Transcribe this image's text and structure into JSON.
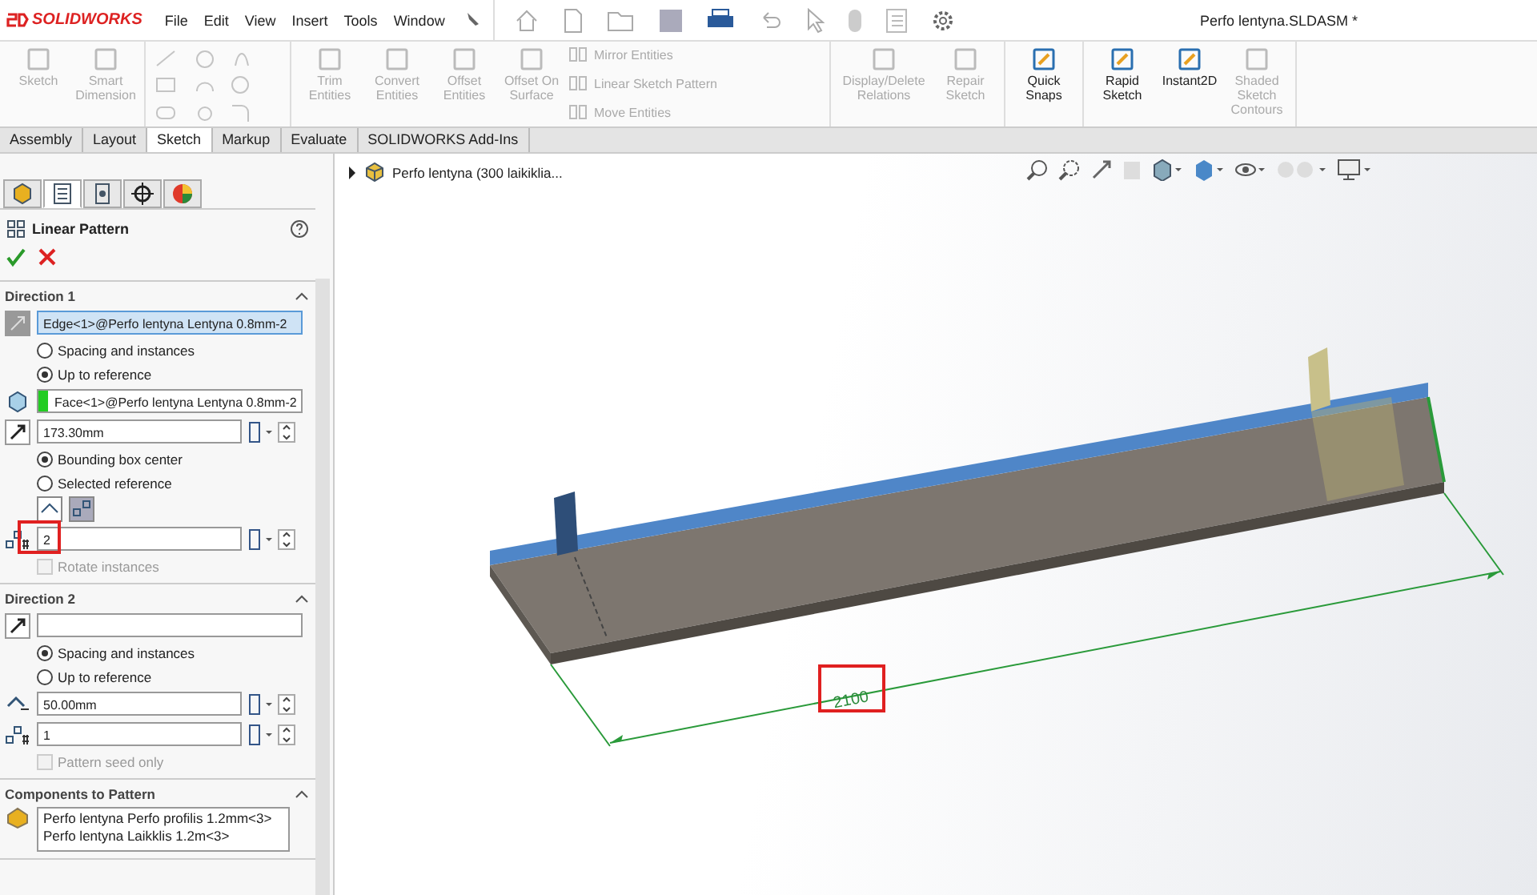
{
  "app": {
    "logo": "SOLIDWORKS"
  },
  "menu": [
    "File",
    "Edit",
    "View",
    "Insert",
    "Tools",
    "Window"
  ],
  "title": "Perfo lentyna.SLDASM *",
  "ribbon": {
    "groups": [
      {
        "items": [
          {
            "label": "Sketch",
            "kind": "large",
            "disabled": true
          },
          {
            "label": "Smart Dimension",
            "kind": "large",
            "disabled": true
          }
        ]
      },
      {
        "items": [
          {
            "kind": "tools",
            "disabled": true
          }
        ]
      },
      {
        "items": [
          {
            "label": "Trim Entities",
            "kind": "large",
            "disabled": true
          },
          {
            "label": "Convert Entities",
            "kind": "large",
            "disabled": true
          },
          {
            "label": "Offset Entities",
            "kind": "large",
            "disabled": true
          },
          {
            "label": "Offset On Surface",
            "kind": "large",
            "disabled": true
          },
          {
            "label": "Mirror Entities",
            "kind": "small",
            "disabled": true
          },
          {
            "label": "Linear Sketch Pattern",
            "kind": "small",
            "disabled": true
          },
          {
            "label": "Move Entities",
            "kind": "small",
            "disabled": true
          }
        ]
      },
      {
        "items": [
          {
            "label": "Display/Delete Relations",
            "kind": "large",
            "disabled": true
          },
          {
            "label": "Repair Sketch",
            "kind": "large",
            "disabled": true
          }
        ]
      },
      {
        "items": [
          {
            "label": "Quick Snaps",
            "kind": "large",
            "disabled": false
          }
        ]
      },
      {
        "items": [
          {
            "label": "Rapid Sketch",
            "kind": "large",
            "disabled": false
          },
          {
            "label": "Instant2D",
            "kind": "large",
            "disabled": false
          },
          {
            "label": "Shaded Sketch Contours",
            "kind": "large",
            "disabled": true
          }
        ]
      }
    ]
  },
  "tabs": [
    {
      "label": "Assembly",
      "selected": false
    },
    {
      "label": "Layout",
      "selected": false
    },
    {
      "label": "Sketch",
      "selected": true
    },
    {
      "label": "Markup",
      "selected": false
    },
    {
      "label": "Evaluate",
      "selected": false
    },
    {
      "label": "SOLIDWORKS Add-Ins",
      "selected": false
    }
  ],
  "panel_tabs": [
    {
      "selected": false
    },
    {
      "selected": true
    },
    {
      "selected": false
    },
    {
      "selected": false
    },
    {
      "selected": false
    }
  ],
  "feature": {
    "title": "Linear Pattern"
  },
  "direction_1": {
    "heading": "Direction 1",
    "edge": "Edge<1>@Perfo lentyna Lentyna 0.8mm-2",
    "modes": [
      {
        "label": "Spacing and instances",
        "selected": false
      },
      {
        "label": "Up to reference",
        "selected": true
      }
    ],
    "face": "Face<1>@Perfo lentyna Lentyna 0.8mm-2",
    "offset": "173.30mm",
    "references": [
      {
        "label": "Bounding box center",
        "selected": true
      },
      {
        "label": "Selected reference",
        "selected": false
      }
    ],
    "instances": {
      "value": "2",
      "highlighted": true
    },
    "rotate": {
      "label": "Rotate instances",
      "checked": false,
      "disabled": true
    }
  },
  "direction_2": {
    "heading": "Direction 2",
    "modes": [
      {
        "label": "Spacing and instances",
        "selected": true
      },
      {
        "label": "Up to reference",
        "selected": false
      }
    ],
    "spacing": "50.00mm",
    "instances": {
      "value": "1",
      "highlighted": false
    },
    "seed": {
      "label": "Pattern seed only",
      "checked": false,
      "disabled": true
    }
  },
  "components": {
    "heading": "Components to Pattern",
    "items": [
      "Perfo lentyna Perfo profilis 1.2mm<3>",
      "Perfo lentyna Laikklis 1.2m<3>"
    ]
  },
  "tree": {
    "root": "Perfo lentyna (300 laikiklia..."
  },
  "model": {
    "dimension": "2100",
    "highlighted": true
  }
}
